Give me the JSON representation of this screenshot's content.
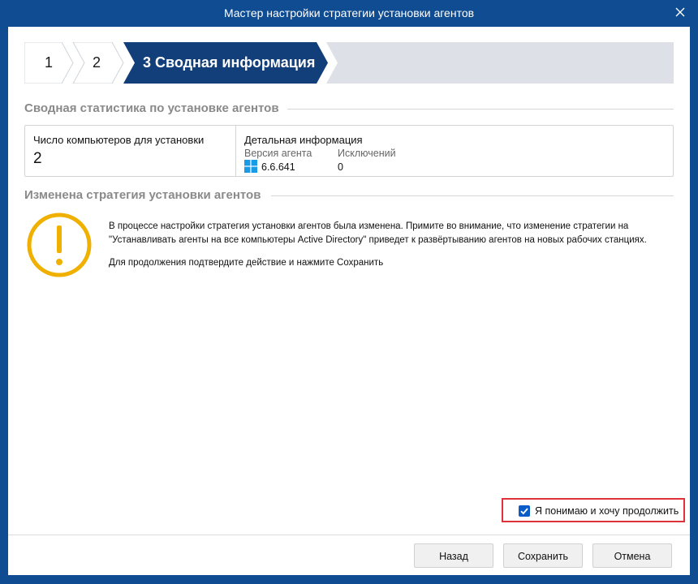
{
  "window": {
    "title": "Мастер настройки стратегии установки агентов",
    "close_icon": "close-icon"
  },
  "stepper": {
    "steps": [
      {
        "label": "1",
        "state": "done"
      },
      {
        "label": "2",
        "state": "done"
      },
      {
        "label": "3 Сводная информация",
        "state": "active"
      }
    ],
    "active_color": "#123f7a",
    "inactive_color": "#dde1e7"
  },
  "summary": {
    "header": "Сводная статистика по установке агентов",
    "computers_label": "Число компьютеров для установки",
    "computers_value": "2",
    "detail_title": "Детальная информация",
    "agent_version_label": "Версия агента",
    "agent_version_icon": "windows-icon",
    "agent_version_value": "6.6.641",
    "exclusions_label": "Исключений",
    "exclusions_value": "0"
  },
  "warning": {
    "header": "Изменена стратегия установки агентов",
    "icon": "warning-icon",
    "icon_color": "#f0b000",
    "line1": "В процессе настройки стратегия установки агентов была изменена. Примите во внимание, что изменение стратегии на",
    "line2": "\"Устанавливать агенты на все компьютеры Active Directory\" приведет к развёртыванию агентов на новых рабочих станциях.",
    "line3": "Для продолжения подтвердите действие и нажмите Сохранить"
  },
  "confirm": {
    "label": "Я понимаю и хочу продолжить",
    "checked": true,
    "highlight_color": "#e0323a"
  },
  "buttons": {
    "back": "Назад",
    "save": "Сохранить",
    "cancel": "Отмена"
  },
  "colors": {
    "window_frame": "#0f4c92",
    "checkbox": "#0a5cc8"
  }
}
